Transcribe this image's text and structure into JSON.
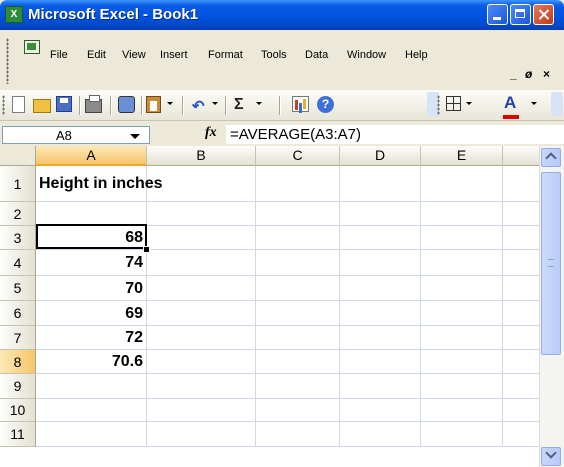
{
  "window": {
    "app_icon_glyph": "X",
    "title": "Microsoft Excel - Book1"
  },
  "menu": {
    "items": [
      "File",
      "Edit",
      "View",
      "Insert",
      "Format",
      "Tools",
      "Data",
      "Window",
      "Help"
    ],
    "doc_minimize": "_",
    "doc_restore": "ø",
    "doc_close": "×"
  },
  "toolbar": {
    "icons": [
      "new-icon",
      "open-icon",
      "save-icon",
      "print-icon",
      "find-icon",
      "paste-icon",
      "undo-icon",
      "autosum-icon",
      "chart-wizard-icon",
      "help-icon",
      "borders-icon",
      "font-color-icon"
    ],
    "undo_glyph": "↶",
    "autosum_glyph": "Σ",
    "help_glyph": "?",
    "font_color_glyph": "A",
    "font_color": "#e00000"
  },
  "formula_bar": {
    "name_box": "A8",
    "fx_label": "fx",
    "formula": "=AVERAGE(A3:A7)"
  },
  "sheet": {
    "columns": [
      "A",
      "B",
      "C",
      "D",
      "E"
    ],
    "selected_column": "A",
    "rows": [
      "1",
      "2",
      "3",
      "4",
      "5",
      "6",
      "7",
      "8",
      "9",
      "10",
      "11"
    ],
    "selected_row": "8",
    "cells": {
      "A1": "Height in inches",
      "A3": "68",
      "A4": "74",
      "A5": "70",
      "A6": "69",
      "A7": "72",
      "A8": "70.6"
    },
    "active_cell": "A8"
  },
  "colors": {
    "title_bar": "#0053e1",
    "selection_header": "#f6c66a",
    "close_button": "#c13a18"
  }
}
